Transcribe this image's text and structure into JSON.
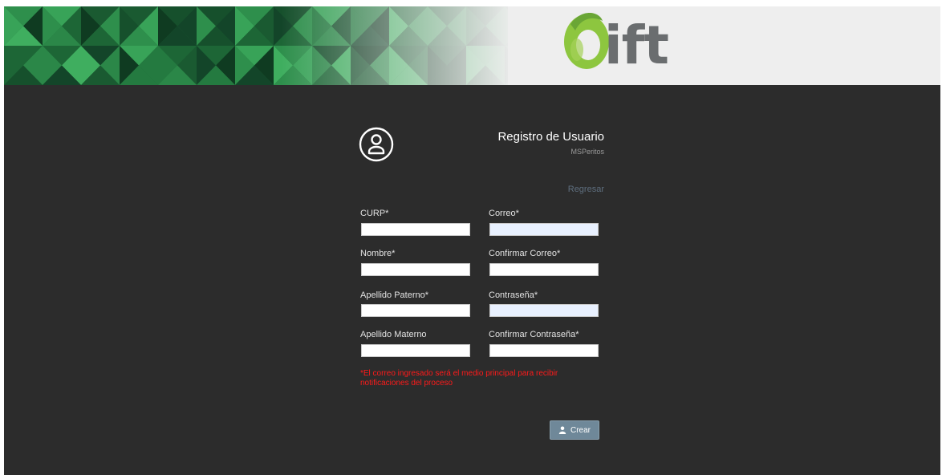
{
  "banner": {
    "logo_text": "ift",
    "colors": {
      "dark_green": "#1c4d2c",
      "green": "#2d9b4f",
      "logo_lime": "#8dc63f"
    }
  },
  "form": {
    "icon": "user-circle-icon",
    "title": "Registro de Usuario",
    "subtitle": "MSPeritos",
    "back_link": "Regresar",
    "fields": {
      "curp": {
        "label": "CURP*",
        "value": ""
      },
      "correo": {
        "label": "Correo*",
        "value": ""
      },
      "nombre": {
        "label": "Nombre*",
        "value": ""
      },
      "confirmar_correo": {
        "label": "Confirmar Correo*",
        "value": ""
      },
      "apellido_paterno": {
        "label": "Apellido Paterno*",
        "value": ""
      },
      "contrasena": {
        "label": "Contraseña*",
        "value": ""
      },
      "apellido_materno": {
        "label": "Apellido Materno",
        "value": ""
      },
      "confirmar_contrasena": {
        "label": "Confirmar Contraseña*",
        "value": ""
      }
    },
    "notice": "*El correo ingresado será el medio principal para recibir notificaciones del proceso",
    "create_button": {
      "label": "Crear",
      "icon": "user-icon"
    }
  },
  "colors": {
    "background": "#2c2c2c",
    "notice": "#ff1a1a",
    "button": "#6f8899",
    "link": "#5e6e7e"
  }
}
